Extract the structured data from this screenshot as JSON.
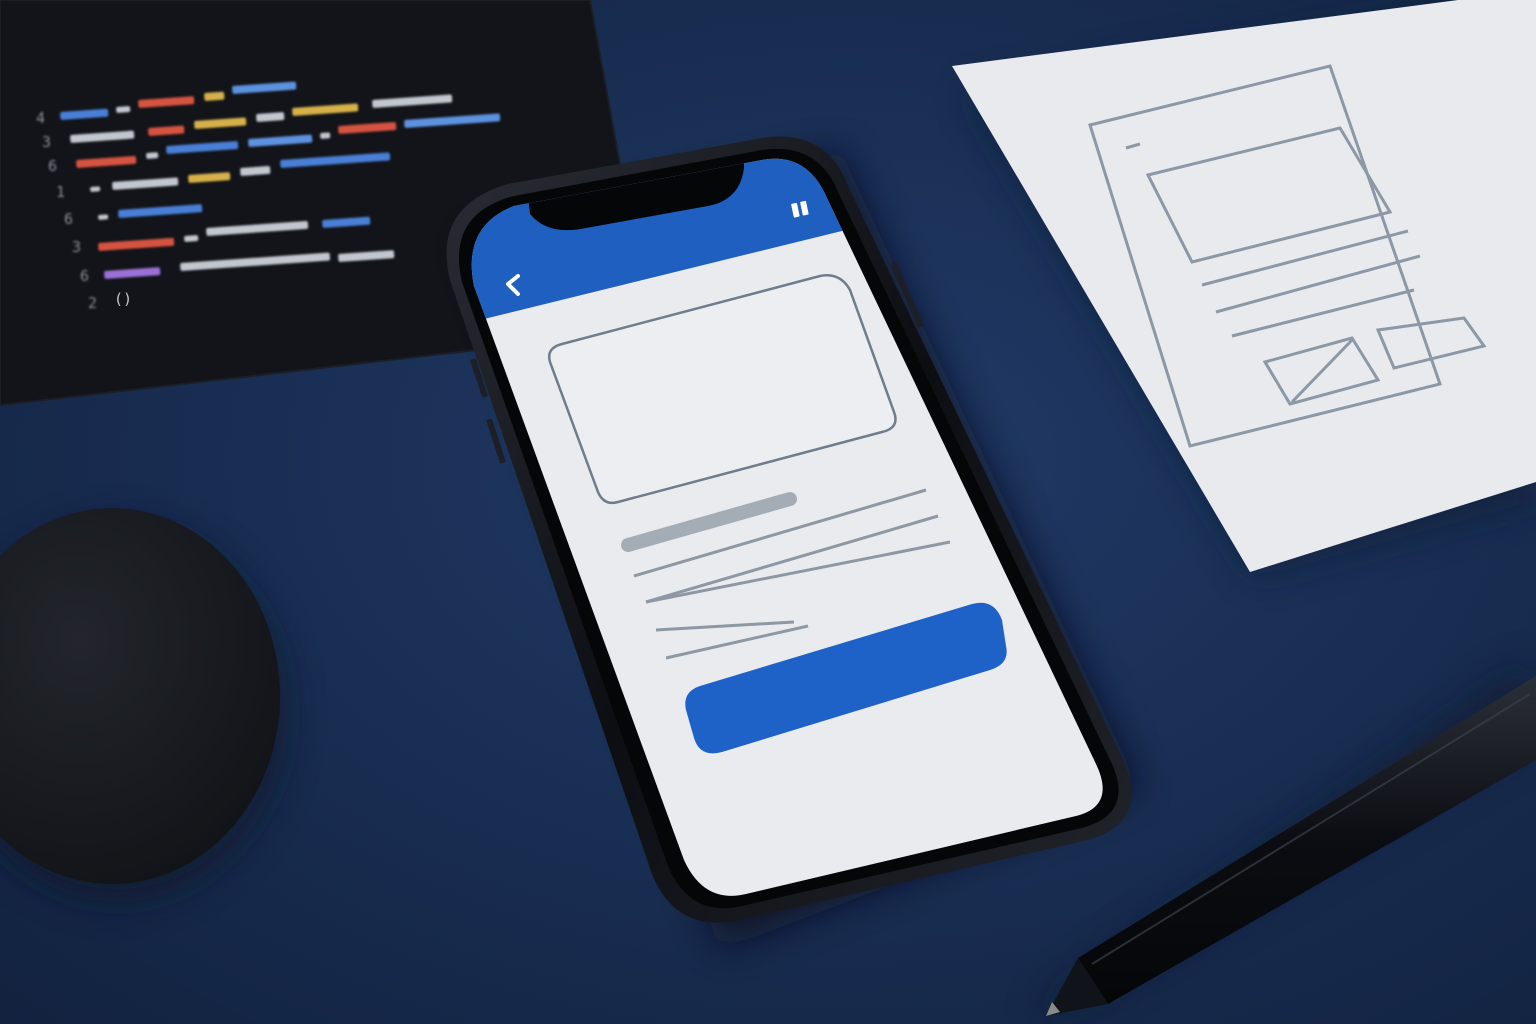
{
  "colors": {
    "desk": "#1a2f55",
    "desk_shadow": "#0f1c36",
    "phone_body": "#0d0f14",
    "screen_bg": "#e9ebef",
    "app_header": "#1f5fbf",
    "wire_stroke": "#6f7c8c",
    "wire_bar": "#a4acb6",
    "cta_button": "#1f62c7",
    "paper": "#e8eaee",
    "paper_stroke": "#8c98a6",
    "code_card": "#121419",
    "coaster": "#15171c",
    "pen": "#0b0d12"
  },
  "icons": {
    "back": "chevron-left-icon",
    "header_action": "bookmark-icon"
  },
  "code_card": {
    "line_numbers": [
      "4",
      "3",
      "6",
      "1",
      "6",
      "3",
      "6",
      "2"
    ],
    "last_line_text": "()"
  }
}
